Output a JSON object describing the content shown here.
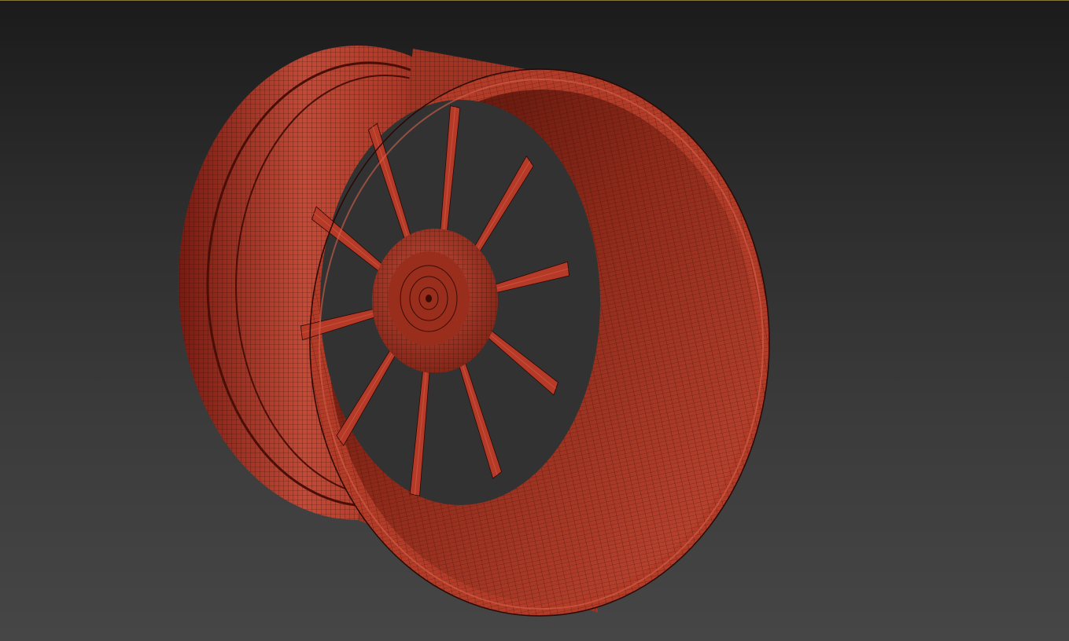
{
  "viewport": {
    "shading": "wireframe-over-shaded",
    "active_border_color": "#8a7a3a",
    "background_top": "#1b1b1b",
    "background_bottom": "#464646"
  },
  "model": {
    "object": "wheel-rim",
    "spoke_count": 10,
    "colors": {
      "base": "#b63a28",
      "dark": "#5a1208",
      "highlight": "#d8604a",
      "wire": "#2a0804"
    }
  }
}
